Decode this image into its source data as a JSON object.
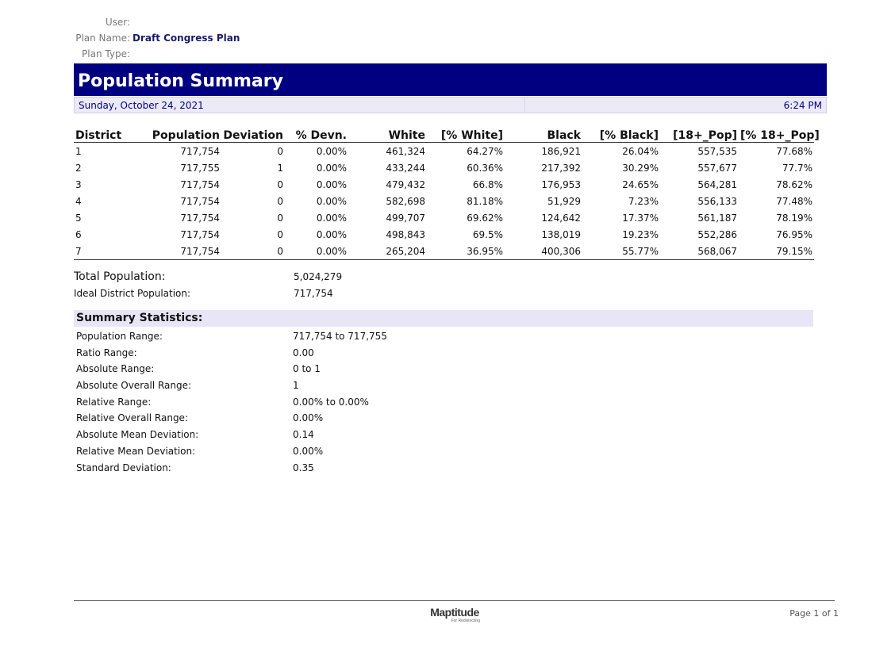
{
  "meta": {
    "user_label": "User:",
    "user_value": "",
    "plan_name_label": "Plan Name:",
    "plan_name_value": "Draft Congress Plan",
    "plan_type_label": "Plan Type:",
    "plan_type_value": ""
  },
  "report": {
    "title": "Population Summary",
    "date": "Sunday, October 24, 2021",
    "time": "6:24 PM"
  },
  "table": {
    "columns": [
      "District",
      "Population",
      "Deviation",
      "% Devn.",
      "White",
      "[% White]",
      "Black",
      "[% Black]",
      "[18+_Pop]",
      "[% 18+_Pop]"
    ],
    "rows": [
      [
        "1",
        "717,754",
        "0",
        "0.00%",
        "461,324",
        "64.27%",
        "186,921",
        "26.04%",
        "557,535",
        "77.68%"
      ],
      [
        "2",
        "717,755",
        "1",
        "0.00%",
        "433,244",
        "60.36%",
        "217,392",
        "30.29%",
        "557,677",
        "77.7%"
      ],
      [
        "3",
        "717,754",
        "0",
        "0.00%",
        "479,432",
        "66.8%",
        "176,953",
        "24.65%",
        "564,281",
        "78.62%"
      ],
      [
        "4",
        "717,754",
        "0",
        "0.00%",
        "582,698",
        "81.18%",
        "51,929",
        "7.23%",
        "556,133",
        "77.48%"
      ],
      [
        "5",
        "717,754",
        "0",
        "0.00%",
        "499,707",
        "69.62%",
        "124,642",
        "17.37%",
        "561,187",
        "78.19%"
      ],
      [
        "6",
        "717,754",
        "0",
        "0.00%",
        "498,843",
        "69.5%",
        "138,019",
        "19.23%",
        "552,286",
        "76.95%"
      ],
      [
        "7",
        "717,754",
        "0",
        "0.00%",
        "265,204",
        "36.95%",
        "400,306",
        "55.77%",
        "568,067",
        "79.15%"
      ]
    ]
  },
  "totals": {
    "total_population_label": "Total Population:",
    "total_population_value": "5,024,279",
    "ideal_label": "Ideal District Population:",
    "ideal_value": "717,754"
  },
  "summary": {
    "header": "Summary Statistics:",
    "rows": [
      {
        "label": "Population Range:",
        "value": "717,754 to 717,755"
      },
      {
        "label": "Ratio Range:",
        "value": "0.00"
      },
      {
        "label": "Absolute Range:",
        "value": "0 to 1"
      },
      {
        "label": "Absolute Overall Range:",
        "value": "1"
      },
      {
        "label": "Relative Range:",
        "value": "0.00% to 0.00%"
      },
      {
        "label": "Relative Overall Range:",
        "value": "0.00%"
      },
      {
        "label": "Absolute Mean Deviation:",
        "value": "0.14"
      },
      {
        "label": "Relative Mean Deviation:",
        "value": "0.00%"
      },
      {
        "label": "Standard Deviation:",
        "value": "0.35"
      }
    ]
  },
  "footer": {
    "logo_text": "Maptitude",
    "logo_sub": "For Redistricting",
    "page": "Page 1 of 1"
  },
  "colors": {
    "banner": "#000080",
    "band": "#eceaf7"
  }
}
